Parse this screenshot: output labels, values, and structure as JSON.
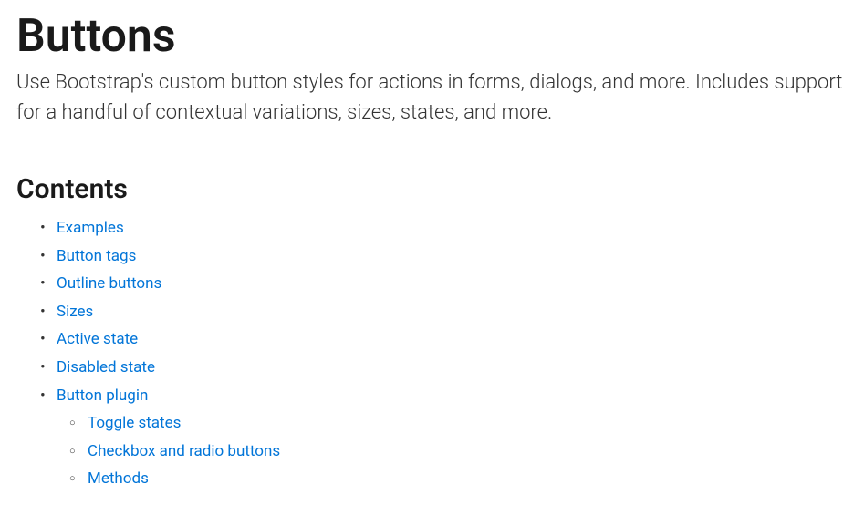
{
  "title": "Buttons",
  "subtitle": "Use Bootstrap's custom button styles for actions in forms, dialogs, and more. Includes support for a handful of contextual variations, sizes, states, and more.",
  "contents": {
    "heading": "Contents",
    "items": [
      {
        "label": "Examples"
      },
      {
        "label": "Button tags"
      },
      {
        "label": "Outline buttons"
      },
      {
        "label": "Sizes"
      },
      {
        "label": "Active state"
      },
      {
        "label": "Disabled state"
      },
      {
        "label": "Button plugin",
        "children": [
          {
            "label": "Toggle states"
          },
          {
            "label": "Checkbox and radio buttons"
          },
          {
            "label": "Methods"
          }
        ]
      }
    ]
  }
}
